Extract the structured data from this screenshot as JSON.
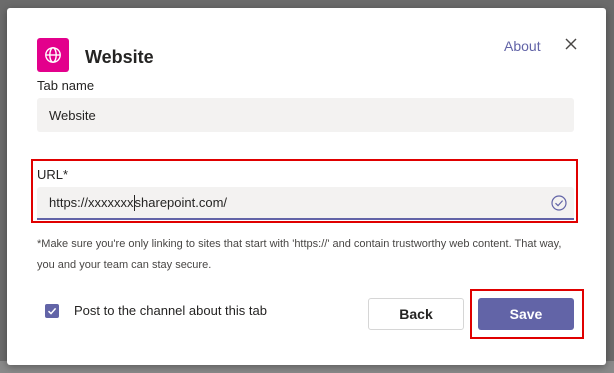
{
  "colors": {
    "accent": "#6264a7",
    "app_icon": "#e3008c",
    "highlight": "#e00000"
  },
  "header": {
    "app_icon": "globe-icon",
    "title": "Website",
    "about_link": "About",
    "close_icon": "close-icon"
  },
  "tab_name": {
    "label": "Tab name",
    "value": "Website"
  },
  "url": {
    "label": "URL*",
    "value_before_caret": "https://xxxxxxx",
    "value_after_caret": "sharepoint.com/",
    "status_icon": "check-circle-icon"
  },
  "note": {
    "text": "*Make sure you're only linking to sites that start with 'https://' and contain trustworthy web content. That way, you and your team can stay secure."
  },
  "post_to_channel": {
    "checked": true,
    "label": "Post to the channel about this tab"
  },
  "buttons": {
    "back": "Back",
    "save": "Save"
  }
}
